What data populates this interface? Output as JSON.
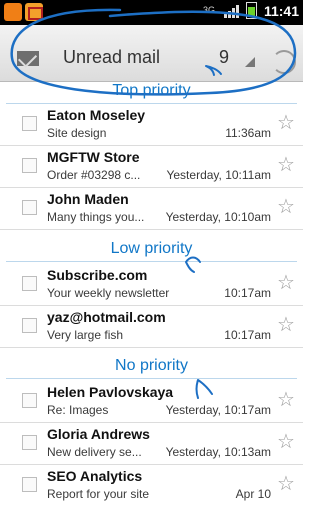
{
  "status_bar": {
    "icons": [
      "notification-icon",
      "gmail-icon",
      "network-3g-icon",
      "signal-icon",
      "battery-icon"
    ],
    "network_label": "3G",
    "time": "11:41"
  },
  "header": {
    "title": "Unread mail",
    "count": "9",
    "icons": [
      "mail-icon",
      "dropdown-caret-icon",
      "refresh-icon"
    ]
  },
  "sections": [
    {
      "label": "Top priority",
      "rows": [
        {
          "sender": "Eaton Moseley",
          "subject": "Site design",
          "date": "11:36am"
        },
        {
          "sender": "MGFTW Store",
          "subject": "Order #03298 c...",
          "date": "Yesterday, 10:11am"
        },
        {
          "sender": "John Maden",
          "subject": "Many things you...",
          "date": "Yesterday, 10:10am"
        }
      ]
    },
    {
      "label": "Low priority",
      "rows": [
        {
          "sender": "Subscribe.com",
          "subject": "Your weekly newsletter",
          "date": "10:17am"
        },
        {
          "sender": "yaz@hotmail.com",
          "subject": "Very large fish",
          "date": "10:17am"
        }
      ]
    },
    {
      "label": "No priority",
      "rows": [
        {
          "sender": "Helen Pavlovskaya",
          "subject": "Re: Images",
          "date": "Yesterday, 10:17am"
        },
        {
          "sender": "Gloria Andrews",
          "subject": "New delivery se...",
          "date": "Yesterday, 10:13am"
        },
        {
          "sender": "SEO Analytics",
          "subject": "Report for your site",
          "date": "Apr 10"
        }
      ]
    }
  ],
  "colors": {
    "section_label": "#1177c7",
    "annotation_ink": "#1d6fc4"
  }
}
